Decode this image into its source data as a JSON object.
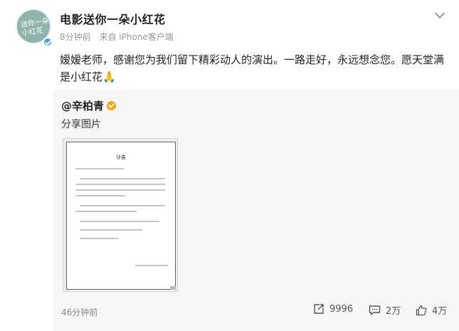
{
  "author": {
    "name": "电影送你一朵小红花",
    "avatar_text": "送你一朵小红花",
    "time": "8分钟前",
    "source": "来自 iPhone客户端"
  },
  "post": {
    "text": "嫒嫒老师，感谢您为我们留下精彩动人的演出。一路走好，永远想念您。愿天堂满是小红花🙏"
  },
  "repost": {
    "user": "@辛柏青",
    "text": "分享图片",
    "image": {
      "title": "讣告"
    },
    "time": "46分钟前",
    "stats": {
      "reposts": "9996",
      "comments": "2万",
      "likes": "4万"
    }
  },
  "icons": [
    "verified-badge-icon",
    "chevron-down-icon",
    "gold-verified-icon",
    "repost-icon",
    "comment-icon",
    "like-icon"
  ]
}
